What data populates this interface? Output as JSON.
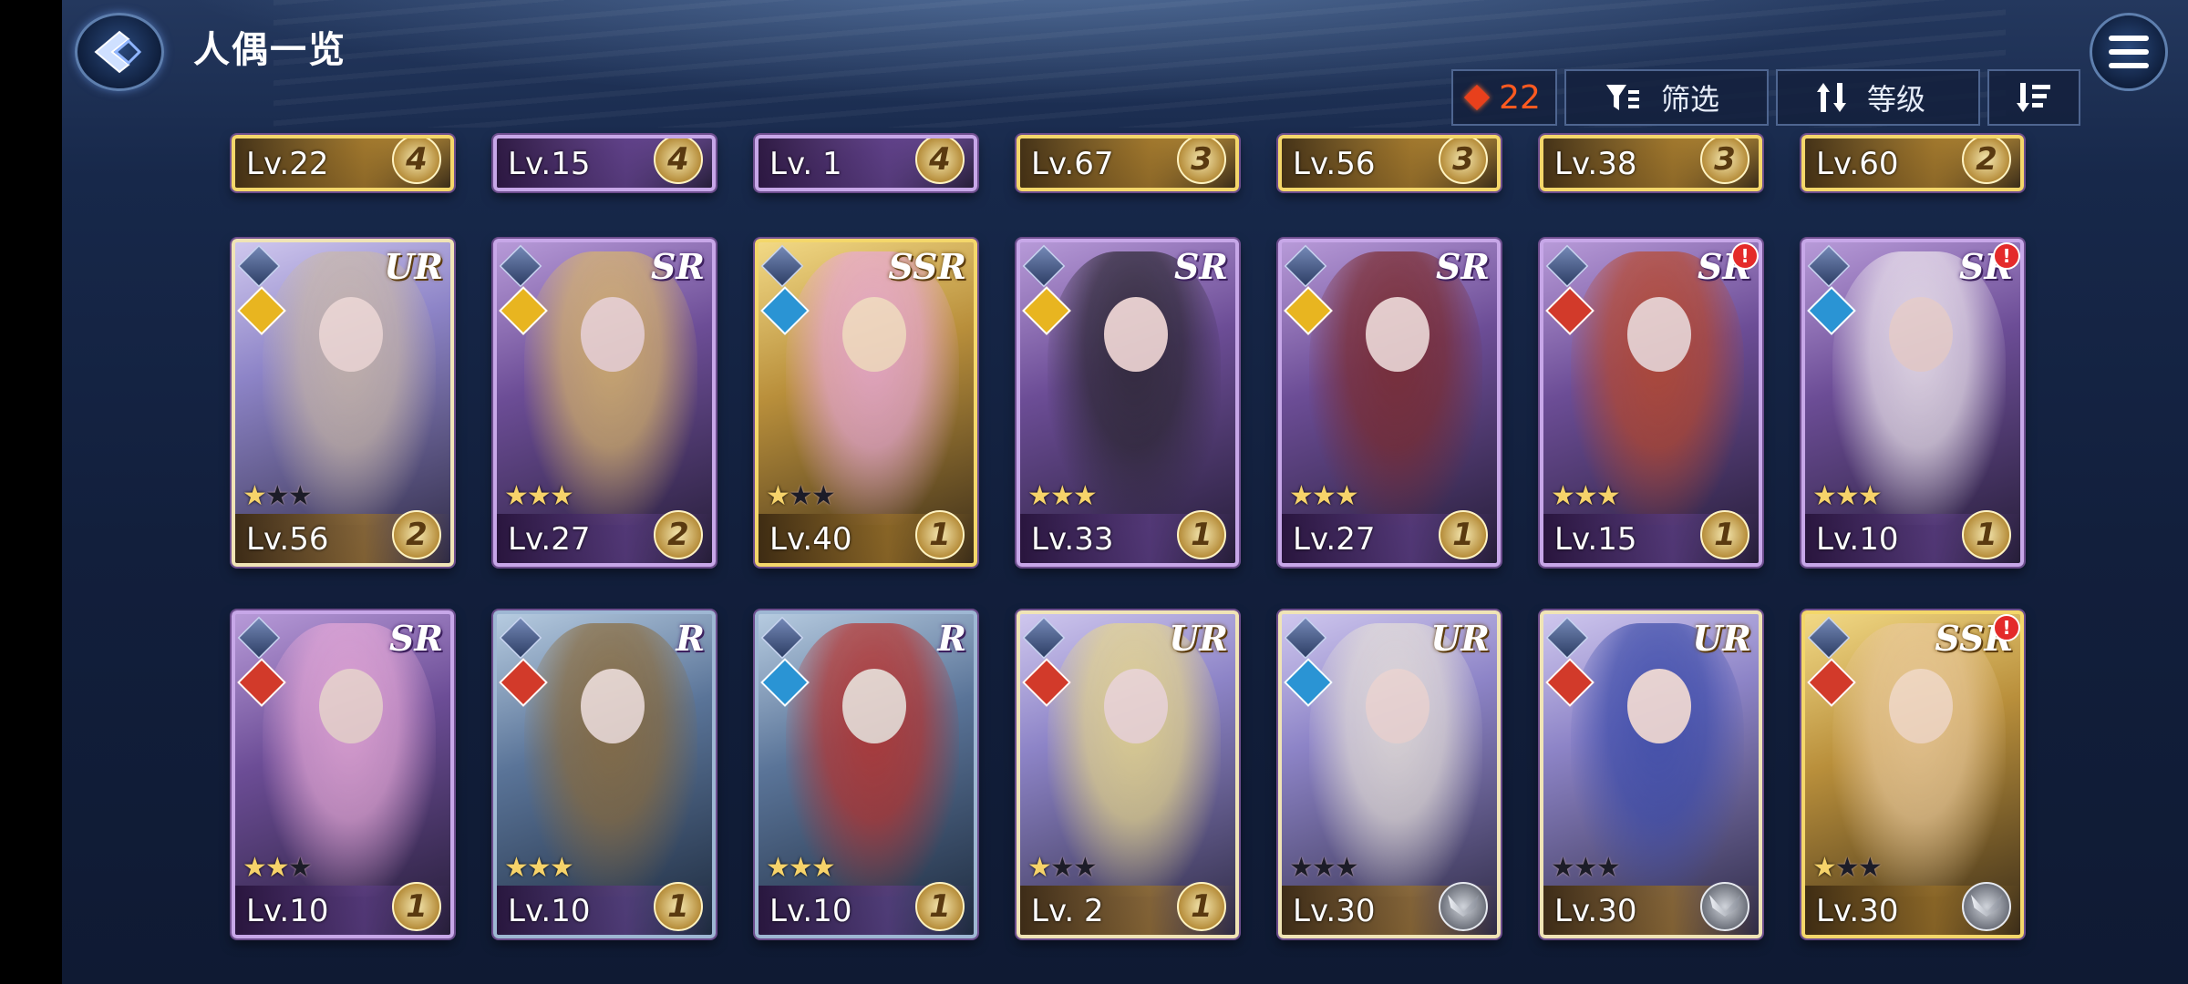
{
  "header": {
    "title": "人偶一览",
    "gem_count": "22",
    "filter_label": "筛选",
    "sort_label": "等级"
  },
  "colors": {
    "gem": "#e8401c",
    "gem_text": "#ff5a20",
    "ur_frame": "#f0e4b6",
    "ssr_frame": "#f4d76a",
    "sr_frame": "#c7a7e8",
    "r_frame": "#9eb7d3"
  },
  "row_top": [
    {
      "level": "Lv.22",
      "count": "4",
      "rarity": "SSR"
    },
    {
      "level": "Lv.15",
      "count": "4",
      "rarity": "SR"
    },
    {
      "level": "Lv. 1",
      "count": "4",
      "rarity": "SR"
    },
    {
      "level": "Lv.67",
      "count": "3",
      "rarity": "SSR"
    },
    {
      "level": "Lv.56",
      "count": "3",
      "rarity": "SSR"
    },
    {
      "level": "Lv.38",
      "count": "3",
      "rarity": "SSR"
    },
    {
      "level": "Lv.60",
      "count": "2",
      "rarity": "SSR"
    }
  ],
  "row_mid": [
    {
      "rarity": "UR",
      "element": "light",
      "stars": 1,
      "level": "Lv.56",
      "count": "2",
      "alert": false,
      "tint": "#c9b8a8"
    },
    {
      "rarity": "SR",
      "element": "light",
      "stars": 3,
      "level": "Lv.27",
      "count": "2",
      "alert": false,
      "tint": "#d9b66a"
    },
    {
      "rarity": "SSR",
      "element": "water",
      "stars": 1,
      "level": "Lv.40",
      "count": "1",
      "alert": false,
      "tint": "#e8a8d8"
    },
    {
      "rarity": "SR",
      "element": "light",
      "stars": 3,
      "level": "Lv.33",
      "count": "1",
      "alert": false,
      "tint": "#2a2630"
    },
    {
      "rarity": "SR",
      "element": "light",
      "stars": 3,
      "level": "Lv.27",
      "count": "1",
      "alert": false,
      "tint": "#7a2a2a"
    },
    {
      "rarity": "SR",
      "element": "fire",
      "stars": 3,
      "level": "Lv.15",
      "count": "1",
      "alert": true,
      "tint": "#b8482a"
    },
    {
      "rarity": "SR",
      "element": "water",
      "stars": 3,
      "level": "Lv.10",
      "count": "1",
      "alert": true,
      "tint": "#efe8ee"
    }
  ],
  "row_bot": [
    {
      "rarity": "SR",
      "element": "fire",
      "stars": 2,
      "level": "Lv.10",
      "count": "1",
      "wings": false,
      "alert": false,
      "tint": "#e8aad8"
    },
    {
      "rarity": "R",
      "element": "fire",
      "stars": 3,
      "level": "Lv.10",
      "count": "1",
      "wings": false,
      "alert": false,
      "tint": "#8a6a3a"
    },
    {
      "rarity": "R",
      "element": "water",
      "stars": 3,
      "level": "Lv.10",
      "count": "1",
      "wings": false,
      "alert": false,
      "tint": "#b8302a"
    },
    {
      "rarity": "UR",
      "element": "fire",
      "stars": 1,
      "level": "Lv. 2",
      "count": "1",
      "wings": false,
      "alert": false,
      "tint": "#e8d88a"
    },
    {
      "rarity": "UR",
      "element": "water",
      "stars": 0,
      "level": "Lv.30",
      "count": "",
      "wings": true,
      "alert": false,
      "tint": "#e6e0d8"
    },
    {
      "rarity": "UR",
      "element": "fire",
      "stars": 0,
      "level": "Lv.30",
      "count": "",
      "wings": true,
      "alert": false,
      "tint": "#3a4aa8"
    },
    {
      "rarity": "SSR",
      "element": "fire",
      "stars": 1,
      "level": "Lv.30",
      "count": "",
      "wings": true,
      "alert": true,
      "tint": "#e8c89a"
    }
  ]
}
